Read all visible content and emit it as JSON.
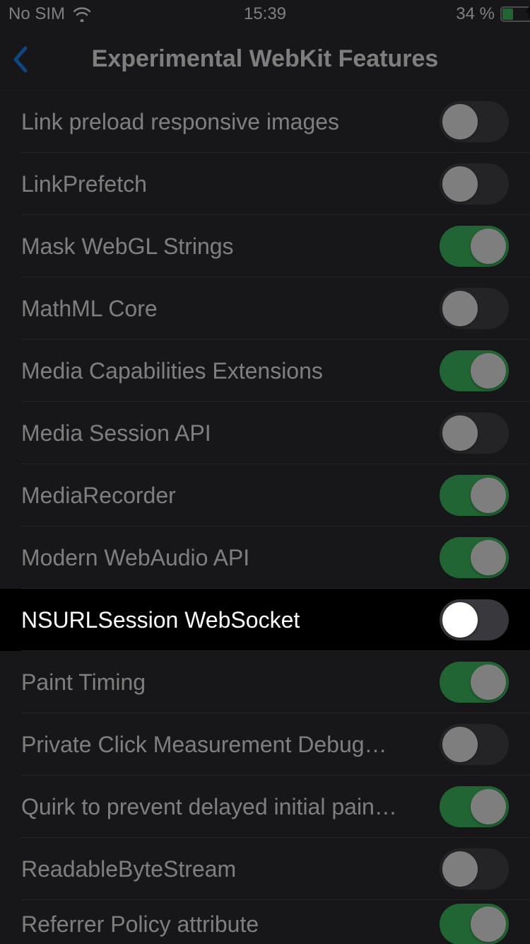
{
  "status": {
    "carrier": "No SIM",
    "time": "15:39",
    "battery_pct_text": "34 %",
    "battery_pct": 34,
    "charging": true
  },
  "nav": {
    "title": "Experimental WebKit Features"
  },
  "rows": [
    {
      "label": "Link preload responsive images",
      "on": false,
      "highlight": false
    },
    {
      "label": "LinkPrefetch",
      "on": false,
      "highlight": false
    },
    {
      "label": "Mask WebGL Strings",
      "on": true,
      "highlight": false
    },
    {
      "label": "MathML Core",
      "on": false,
      "highlight": false
    },
    {
      "label": "Media Capabilities Extensions",
      "on": true,
      "highlight": false
    },
    {
      "label": "Media Session API",
      "on": false,
      "highlight": false
    },
    {
      "label": "MediaRecorder",
      "on": true,
      "highlight": false
    },
    {
      "label": "Modern WebAudio API",
      "on": true,
      "highlight": false
    },
    {
      "label": "NSURLSession WebSocket",
      "on": false,
      "highlight": true
    },
    {
      "label": "Paint Timing",
      "on": true,
      "highlight": false
    },
    {
      "label": "Private Click Measurement Debug Mode",
      "on": false,
      "highlight": false,
      "truncate": "Private Click Measurement Debug…"
    },
    {
      "label": "Quirk to prevent delayed initial painting on sites",
      "on": true,
      "highlight": false,
      "truncate": "Quirk to prevent delayed initial pain…"
    },
    {
      "label": "ReadableByteStream",
      "on": false,
      "highlight": false
    },
    {
      "label": "Referrer Policy attribute",
      "on": true,
      "highlight": false
    }
  ]
}
